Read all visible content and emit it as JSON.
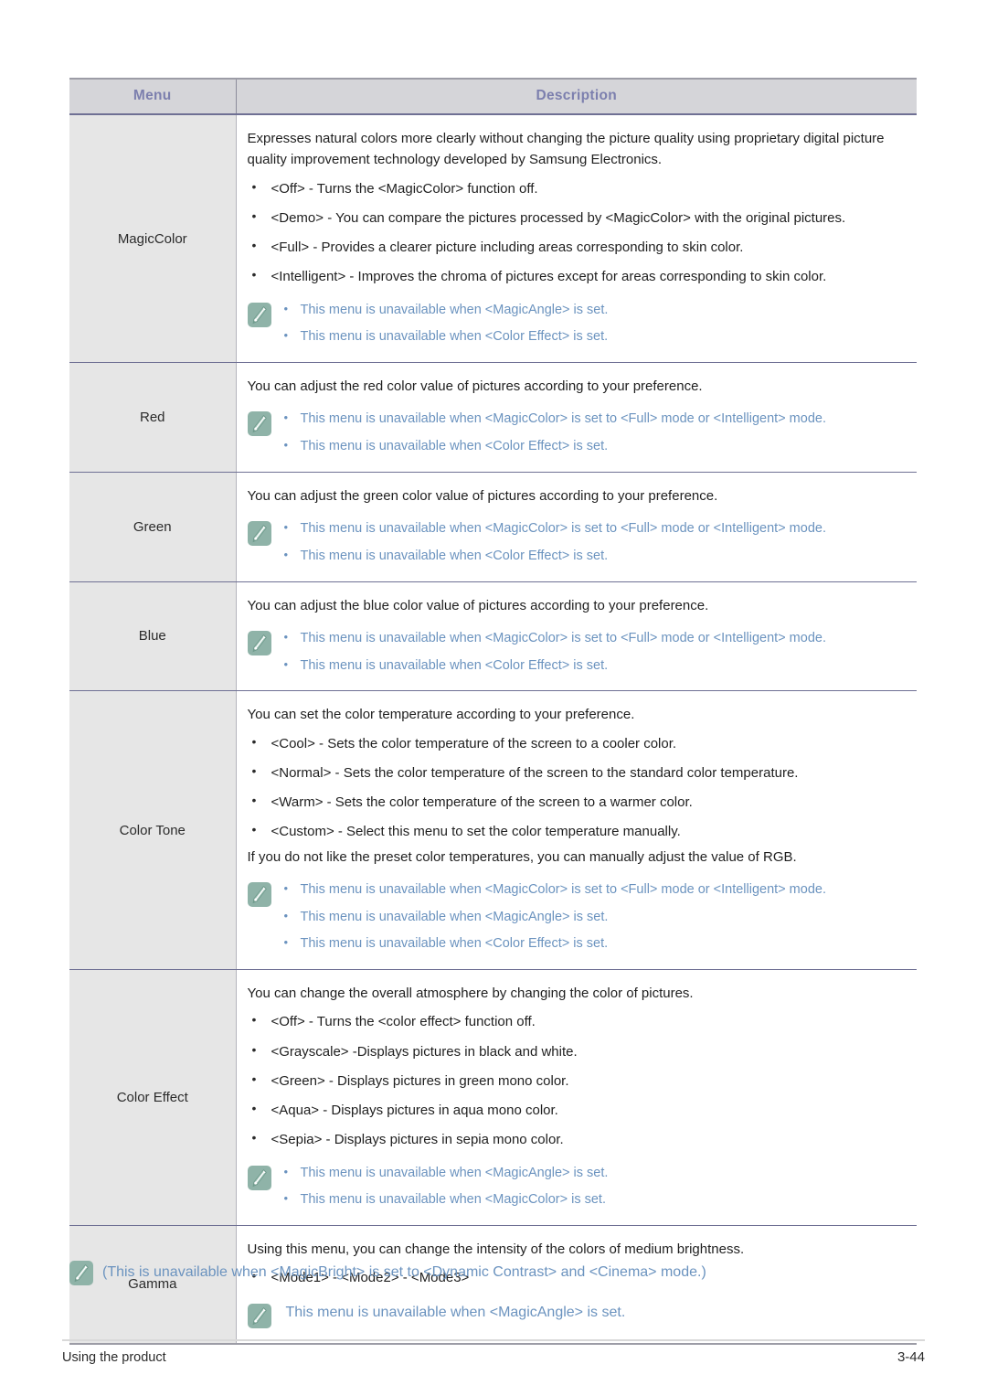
{
  "table": {
    "headers": {
      "menu": "Menu",
      "description": "Description"
    },
    "rows": [
      {
        "menu": "MagicColor",
        "paragraphs": [
          "Expresses natural colors more clearly without changing the picture quality using proprietary digital picture quality improvement technology developed by Samsung Electronics."
        ],
        "bullets": [
          "<Off> - Turns the <MagicColor> function off.",
          "<Demo> - You can compare the pictures processed by <MagicColor> with the original pictures.",
          "<Full> - Provides a clearer picture including areas corresponding to skin color.",
          "<Intelligent> - Improves the chroma of pictures except for areas corresponding to skin color."
        ],
        "notes": [
          "This menu is unavailable when <MagicAngle> is set.",
          "This menu is unavailable when <Color Effect> is set."
        ]
      },
      {
        "menu": "Red",
        "paragraphs": [
          "You can adjust the red color value of pictures according to your preference."
        ],
        "bullets": [],
        "notes": [
          "This menu is unavailable when <MagicColor> is set to <Full> mode or <Intelligent> mode.",
          "This menu is unavailable when <Color Effect> is set."
        ]
      },
      {
        "menu": "Green",
        "paragraphs": [
          "You can adjust the green color value of pictures according to your preference."
        ],
        "bullets": [],
        "notes": [
          "This menu is unavailable when <MagicColor> is set to <Full> mode or <Intelligent> mode.",
          "This menu is unavailable when <Color Effect> is set."
        ]
      },
      {
        "menu": "Blue",
        "paragraphs": [
          "You can adjust the blue color value of pictures according to your preference."
        ],
        "bullets": [],
        "notes": [
          "This menu is unavailable when <MagicColor> is set to <Full> mode or <Intelligent> mode.",
          "This menu is unavailable when <Color Effect> is set."
        ]
      },
      {
        "menu": "Color Tone",
        "paragraphs": [
          "You can set the color temperature according to your preference."
        ],
        "bullets": [
          "<Cool> - Sets the color temperature of the screen to a cooler color.",
          "<Normal> - Sets the color temperature of the screen to the standard color temperature.",
          "<Warm> - Sets the color temperature of the screen to a warmer color.",
          "<Custom> - Select this menu to set the color temperature manually."
        ],
        "trailing_paragraph": "If you do not like the preset color temperatures, you can manually adjust the value of RGB.",
        "notes": [
          "This menu is unavailable when <MagicColor> is set to <Full> mode or <Intelligent> mode.",
          "This menu is unavailable when <MagicAngle> is set.",
          "This menu is unavailable when <Color Effect> is set."
        ]
      },
      {
        "menu": "Color Effect",
        "paragraphs": [
          "You can change the overall atmosphere by changing the color of pictures."
        ],
        "bullets": [
          "<Off> - Turns the <color effect> function off.",
          "<Grayscale> -Displays pictures in black and white.",
          "<Green> - Displays pictures in green mono color.",
          "<Aqua> - Displays pictures in aqua mono color.",
          "<Sepia> - Displays pictures in sepia mono color."
        ],
        "notes": [
          "This menu is unavailable when <MagicAngle> is set.",
          "This menu is unavailable when <MagicColor> is set."
        ]
      },
      {
        "menu": "Gamma",
        "paragraphs": [
          "Using this menu, you can change the intensity of the colors of medium brightness."
        ],
        "bullets": [
          "<Mode1> - <Mode2> - <Mode3>"
        ],
        "notes_nobullet": [
          "This menu is unavailable when <MagicAngle> is set."
        ]
      }
    ]
  },
  "footnote": {
    "text": "(This is unavailable when <MagicBright> is set to <Dynamic Contrast> and <Cinema> mode.)"
  },
  "footer": {
    "left": "Using the product",
    "right": "3-44"
  },
  "colors": {
    "header_bg": "#d5d5d9",
    "header_text": "#7c7fae",
    "menu_cell_bg": "#e6e6e6",
    "note_text": "#6b93bf",
    "note_icon_bg": "#8fb3a8",
    "body_text": "#1f1f1f",
    "rule": "#6f7094"
  }
}
